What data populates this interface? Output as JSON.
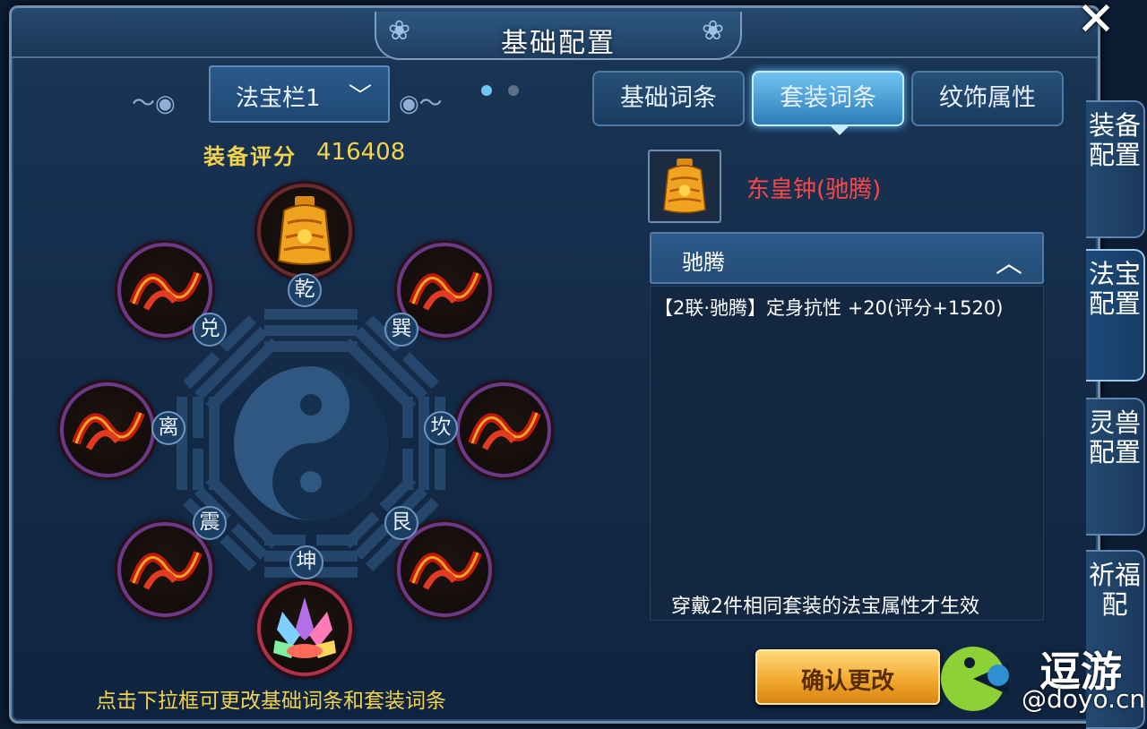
{
  "window": {
    "title": "基础配置",
    "close_icon": "close-x-icon"
  },
  "loadout": {
    "dropdown_label": "法宝栏1",
    "dropdown_icon": "chevron-down-icon",
    "page_indicator": {
      "current": 1,
      "total": 2
    },
    "score_label": "装备评分",
    "score_value": "416408"
  },
  "bagua": {
    "trigrams": [
      "乾",
      "巽",
      "坎",
      "艮",
      "坤",
      "震",
      "离",
      "兑"
    ],
    "slots": [
      {
        "position": "乾",
        "item_icon": "golden-bell-icon"
      },
      {
        "position": "巽",
        "item_icon": "red-ribbon-icon"
      },
      {
        "position": "坎",
        "item_icon": "red-ribbon-icon"
      },
      {
        "position": "艮",
        "item_icon": "red-ribbon-icon"
      },
      {
        "position": "坤",
        "item_icon": "crystal-lotus-icon"
      },
      {
        "position": "震",
        "item_icon": "red-ribbon-icon"
      },
      {
        "position": "离",
        "item_icon": "red-ribbon-icon"
      },
      {
        "position": "兑",
        "item_icon": "red-ribbon-icon"
      }
    ]
  },
  "hint": "点击下拉框可更改基础词条和套装词条",
  "tabs": [
    {
      "label": "基础词条",
      "active": false
    },
    {
      "label": "套装词条",
      "active": true
    },
    {
      "label": "纹饰属性",
      "active": false
    }
  ],
  "selected_item": {
    "name": "东皇钟(驰腾)",
    "icon": "golden-bell-icon",
    "name_color": "#ff4646"
  },
  "set_section": {
    "header": "驰腾",
    "header_icon": "chevron-up-icon",
    "effect_line": "【2联·驰腾】定身抗性 +20(评分+1520)",
    "note": "穿戴2件相同套装的法宝属性才生效"
  },
  "confirm_button": "确认更改",
  "side_tabs": [
    {
      "label": "装备配置",
      "active": false
    },
    {
      "label": "法宝配置",
      "active": true
    },
    {
      "label": "灵兽配置",
      "active": false
    },
    {
      "label": "祈福配",
      "active": false
    }
  ],
  "watermark": {
    "text": "逗游",
    "url": "@doyo.cn"
  },
  "colors": {
    "score": "#f2d34b",
    "hint": "#f2d34b",
    "active_tab": "#6fc4f2",
    "confirm": "#f0a62a"
  }
}
